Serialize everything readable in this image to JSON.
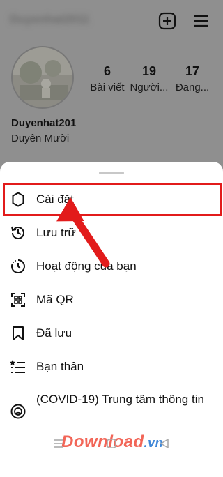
{
  "profile": {
    "username": "Duyenhat2011",
    "stats": [
      {
        "value": "6",
        "label": "Bài viết"
      },
      {
        "value": "19",
        "label": "Người..."
      },
      {
        "value": "17",
        "label": "Đang..."
      }
    ],
    "handle": "Duyenhat201",
    "full_name": "Duyên Mười"
  },
  "menu": {
    "items": [
      {
        "label": "Cài đặt",
        "icon": "settings-gear-icon"
      },
      {
        "label": "Lưu trữ",
        "icon": "archive-history-icon"
      },
      {
        "label": "Hoạt động của bạn",
        "icon": "activity-clock-icon"
      },
      {
        "label": "Mã QR",
        "icon": "qr-code-icon"
      },
      {
        "label": "Đã lưu",
        "icon": "bookmark-icon"
      },
      {
        "label": "Bạn thân",
        "icon": "close-friends-list-icon"
      },
      {
        "label": "(COVID-19) Trung tâm thông tin",
        "icon": "covid-info-icon"
      }
    ]
  },
  "watermark": {
    "text": "Download",
    "suffix": ".vn"
  },
  "colors": {
    "highlight": "#e21b1b",
    "dim": "#8f8f8f"
  }
}
